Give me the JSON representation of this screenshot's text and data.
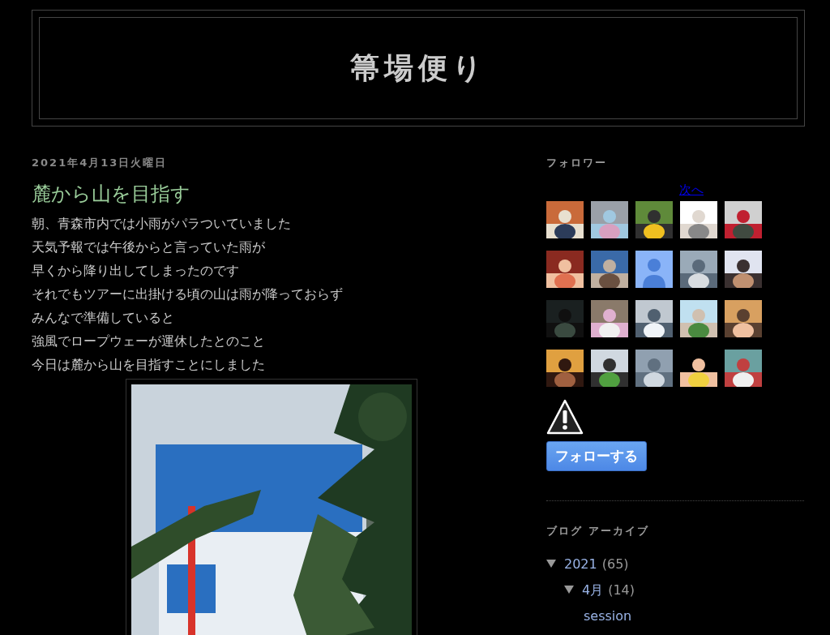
{
  "blog": {
    "title": "箒場便り"
  },
  "post": {
    "date": "2021年4月13日火曜日",
    "title": "麓から山を目指す",
    "lines": [
      "朝、青森市内では小雨がパラついていました",
      "天気予報では午後からと言っていた雨が",
      "早くから降り出してしまったのです",
      "それでもツアーに出掛ける頃の山は雨が降っておらず",
      "みんなで準備していると",
      "強風でロープウェーが運休したとのこと",
      "今日は麓から山を目指すことにしました"
    ],
    "image": {
      "kind": "picture"
    }
  },
  "sidebar": {
    "followers": {
      "heading": "フォロワー",
      "next_link": "次へ",
      "avatars": [
        {
          "kind": "picture"
        },
        {
          "kind": "picture"
        },
        {
          "kind": "picture"
        },
        {
          "kind": "picture"
        },
        {
          "kind": "picture"
        },
        {
          "kind": "picture"
        },
        {
          "kind": "picture"
        },
        {
          "kind": "default"
        },
        {
          "kind": "picture"
        },
        {
          "kind": "picture"
        },
        {
          "kind": "picture"
        },
        {
          "kind": "picture"
        },
        {
          "kind": "picture"
        },
        {
          "kind": "picture"
        },
        {
          "kind": "picture"
        },
        {
          "kind": "picture"
        },
        {
          "kind": "picture"
        },
        {
          "kind": "picture"
        },
        {
          "kind": "picture"
        },
        {
          "kind": "picture"
        }
      ],
      "follow_button": "フォローする"
    },
    "archive": {
      "heading": "ブログ アーカイブ",
      "items": [
        {
          "label": "2021",
          "count": "(65)",
          "expanded": true,
          "children": [
            {
              "label": "4月",
              "count": "(14)",
              "expanded": true,
              "children": [
                {
                  "label": "session"
                }
              ]
            }
          ]
        }
      ]
    }
  }
}
